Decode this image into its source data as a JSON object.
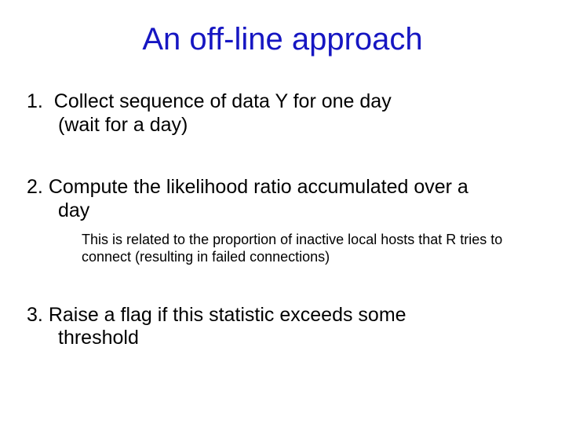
{
  "title": {
    "text": "An off-line approach",
    "color": "#1616c2"
  },
  "items": [
    {
      "num": "1.",
      "line1": "Collect sequence of data Y for one day",
      "line2": "(wait for a day)"
    },
    {
      "num": "2.",
      "line1": "Compute the likelihood ratio accumulated over a",
      "line2": "day",
      "sub_line1": "This is related to the proportion of inactive local hosts that R tries to",
      "sub_line2": "connect (resulting in failed connections)"
    },
    {
      "num": "3.",
      "line1": "Raise a flag if this statistic exceeds some",
      "line2": "threshold"
    }
  ]
}
